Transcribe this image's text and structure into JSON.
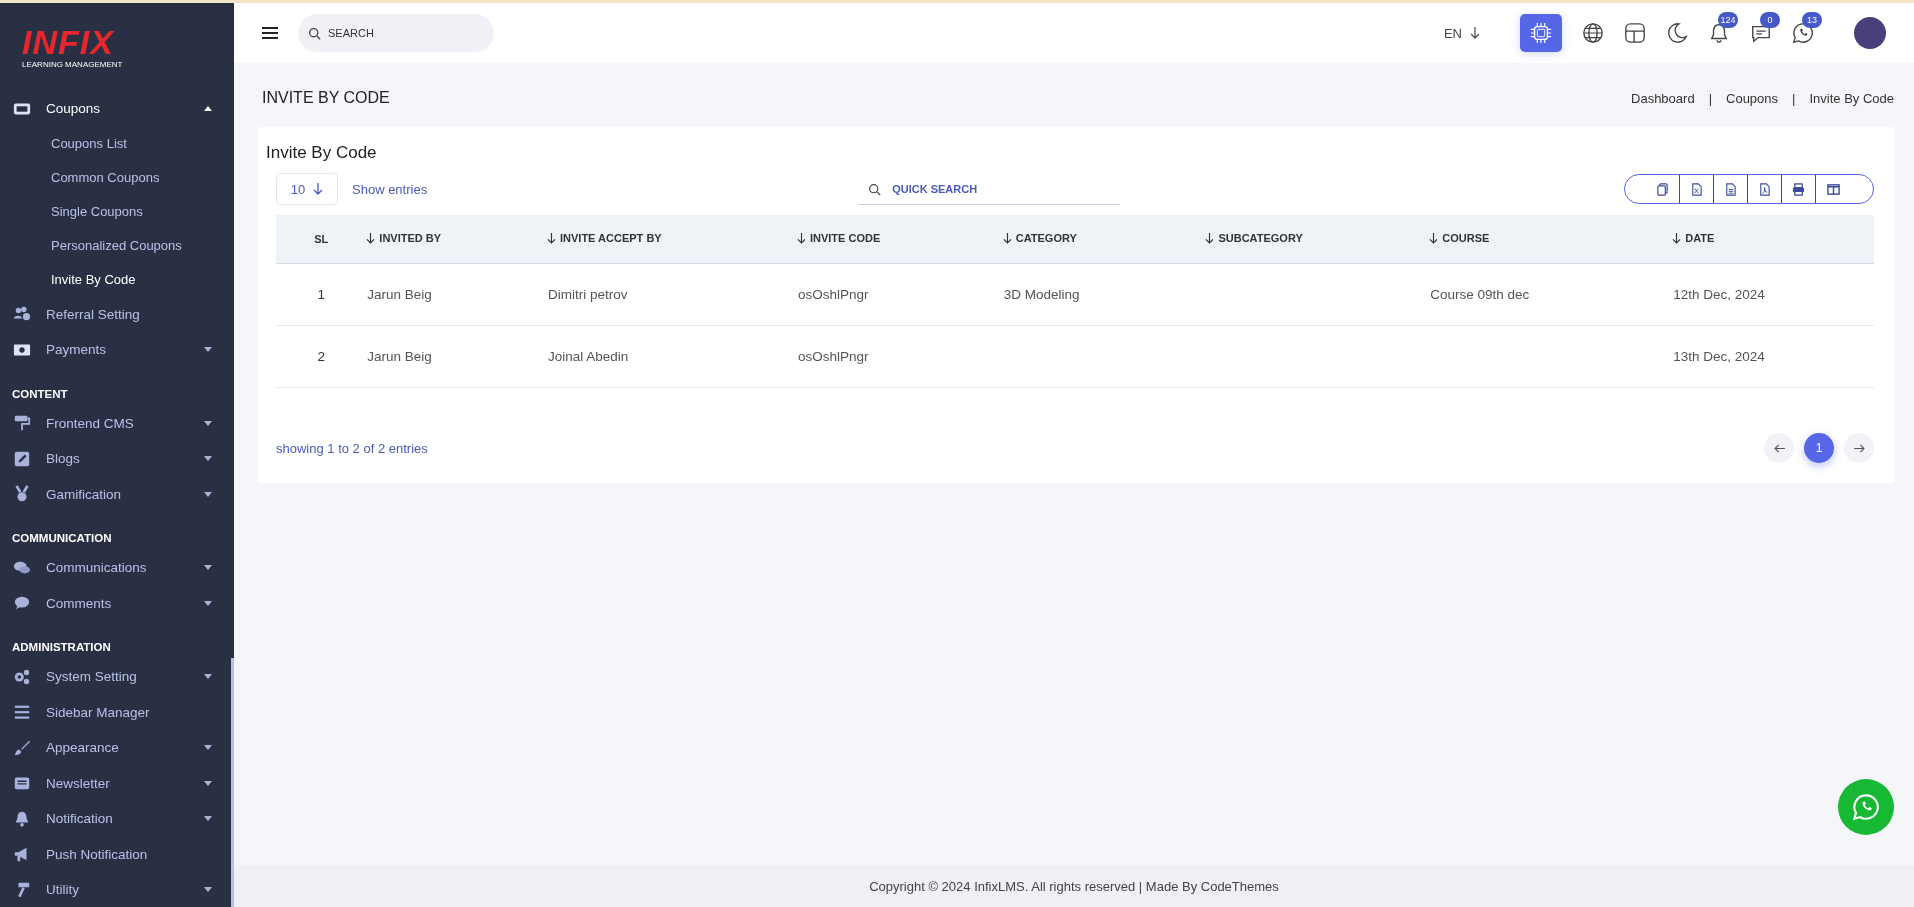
{
  "sidebar": {
    "logo": {
      "title": "INFIX",
      "subtitle": "LEARNING MANAGEMENT"
    },
    "sections": [
      {
        "items": [
          {
            "label": "Coupons",
            "kind": "menu",
            "expanded": true,
            "children": [
              {
                "label": "Coupons List",
                "selected": false
              },
              {
                "label": "Common Coupons",
                "selected": false
              },
              {
                "label": "Single Coupons",
                "selected": false
              },
              {
                "label": "Personalized Coupons",
                "selected": false
              },
              {
                "label": "Invite By Code",
                "selected": true
              }
            ]
          },
          {
            "label": "Referral Setting",
            "kind": "link",
            "expanded": false
          },
          {
            "label": "Payments",
            "kind": "menu",
            "expanded": false
          }
        ]
      },
      {
        "heading": "CONTENT",
        "items": [
          {
            "label": "Frontend CMS",
            "kind": "menu",
            "expanded": false
          },
          {
            "label": "Blogs",
            "kind": "menu",
            "expanded": false
          },
          {
            "label": "Gamification",
            "kind": "menu",
            "expanded": false
          }
        ]
      },
      {
        "heading": "COMMUNICATION",
        "items": [
          {
            "label": "Communications",
            "kind": "menu",
            "expanded": false
          },
          {
            "label": "Comments",
            "kind": "menu",
            "expanded": false
          }
        ]
      },
      {
        "heading": "ADMINISTRATION",
        "items": [
          {
            "label": "System Setting",
            "kind": "menu",
            "expanded": false
          },
          {
            "label": "Sidebar Manager",
            "kind": "link",
            "expanded": false
          },
          {
            "label": "Appearance",
            "kind": "menu",
            "expanded": false
          },
          {
            "label": "Newsletter",
            "kind": "menu",
            "expanded": false
          },
          {
            "label": "Notification",
            "kind": "menu",
            "expanded": false
          },
          {
            "label": "Push Notification",
            "kind": "link",
            "expanded": false
          },
          {
            "label": "Utility",
            "kind": "menu",
            "expanded": false
          }
        ]
      }
    ]
  },
  "topbar": {
    "search": {
      "placeholder": "SEARCH"
    },
    "language": "EN",
    "badges": [
      "124",
      "0",
      "13"
    ]
  },
  "page": {
    "title": "INVITE BY CODE",
    "breadcrumb": {
      "separator": "|",
      "items": [
        "Dashboard",
        "Coupons",
        "Invite By Code"
      ]
    }
  },
  "card": {
    "title": "Invite By Code",
    "page_size": "10",
    "show_entries": "Show entries",
    "search": {
      "placeholder": "QUICK SEARCH"
    },
    "table": {
      "columns": [
        {
          "label": "SL",
          "sortable": false
        },
        {
          "label": "INVITED BY",
          "sortable": true
        },
        {
          "label": "INVITE ACCEPT BY",
          "sortable": true
        },
        {
          "label": "INVITE CODE",
          "sortable": true
        },
        {
          "label": "CATEGORY",
          "sortable": true
        },
        {
          "label": "SUBCATEGORY",
          "sortable": true
        },
        {
          "label": "COURSE",
          "sortable": true
        },
        {
          "label": "DATE",
          "sortable": true
        }
      ],
      "rows": [
        [
          "1",
          "Jarun Beig",
          "Dimitri petrov",
          "osOshlPngr",
          "3D Modeling",
          "",
          "Course 09th dec",
          "12th Dec, 2024"
        ],
        [
          "2",
          "Jarun Beig",
          "Joinal Abedin",
          "osOshlPngr",
          "",
          "",
          "",
          "13th Dec, 2024"
        ]
      ]
    },
    "summary": "showing 1 to 2 of 2 entries",
    "pages": [
      {
        "label": "1",
        "selected": true
      }
    ]
  },
  "footer": "Copyright © 2024 InfixLMS. All rights reserved | Made By CodeThemes"
}
